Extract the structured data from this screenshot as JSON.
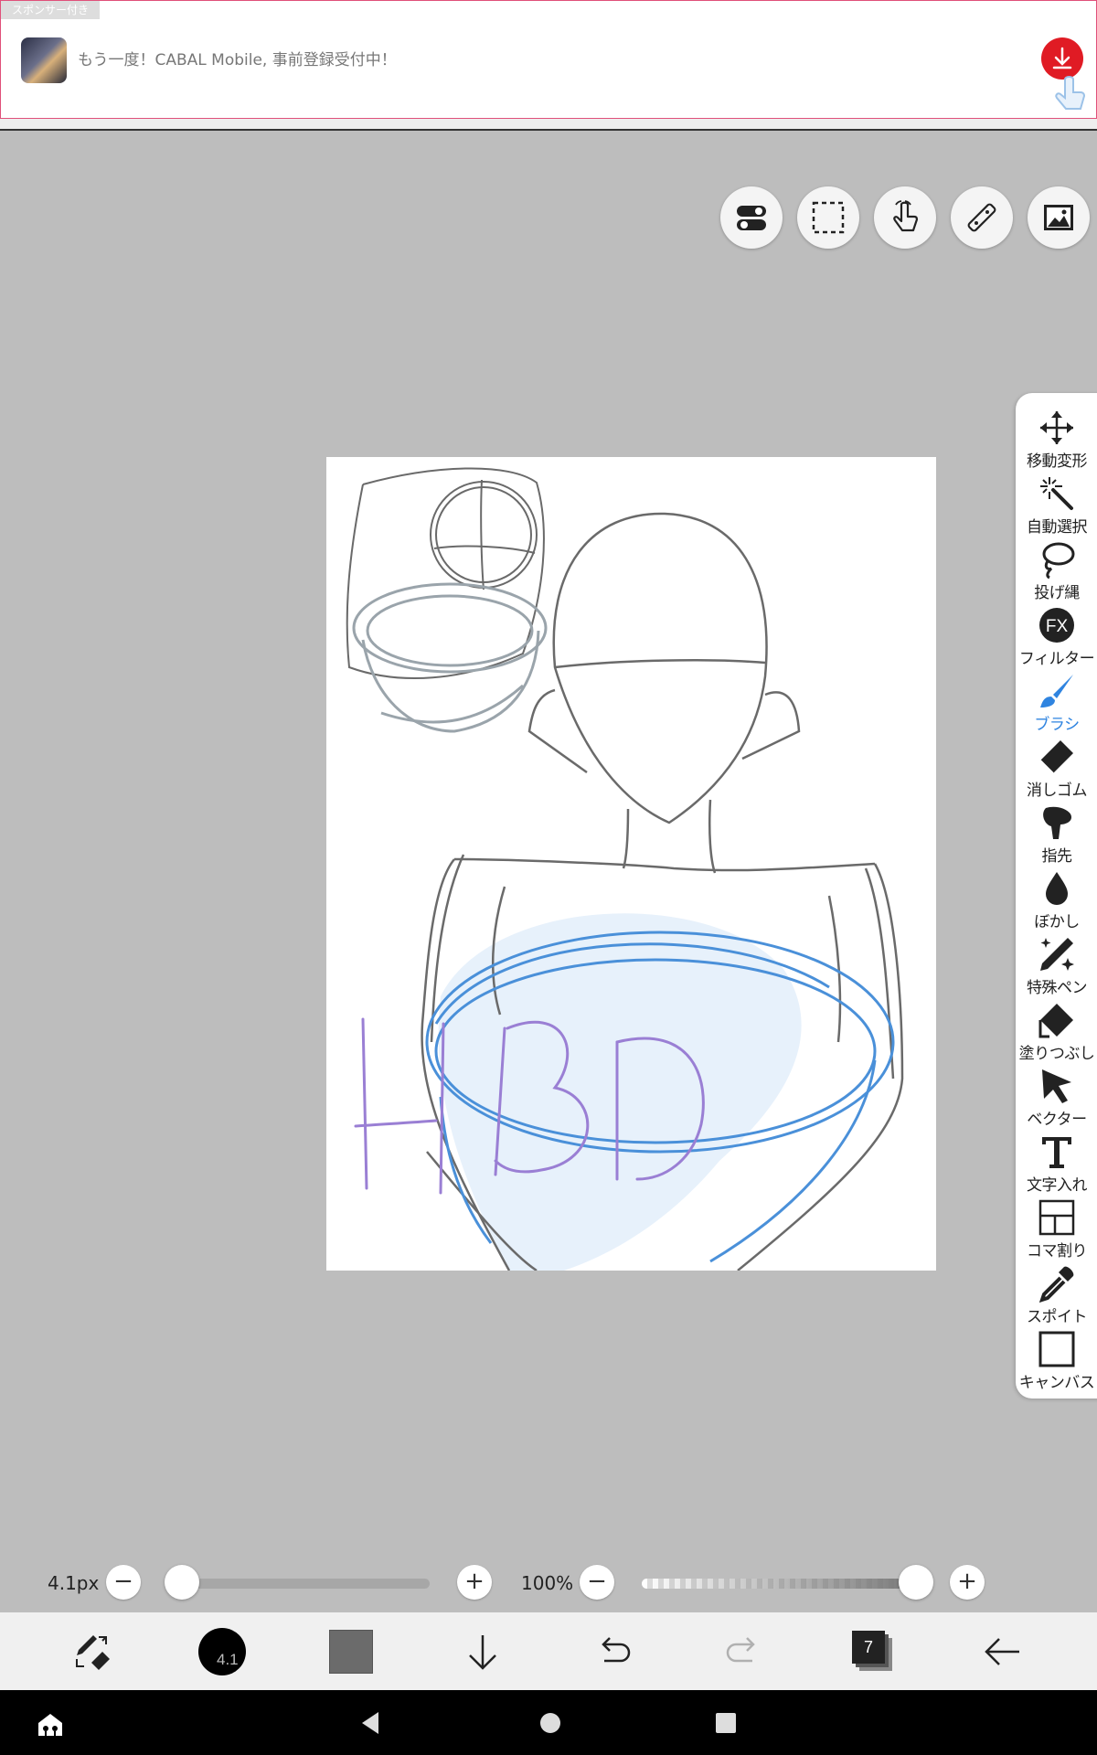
{
  "ad": {
    "tag": "スポンサー付き",
    "text": "もう一度！CABAL Mobile, 事前登録受付中！"
  },
  "top_buttons": [
    "toggle-icon",
    "selection-icon",
    "hand-icon",
    "ruler-icon",
    "image-icon"
  ],
  "canvas": {
    "handwritten_text": "HBD"
  },
  "tools": [
    {
      "label": "移動変形",
      "icon": "move-icon"
    },
    {
      "label": "自動選択",
      "icon": "magic-wand-icon"
    },
    {
      "label": "投げ縄",
      "icon": "lasso-icon"
    },
    {
      "label": "フィルター",
      "icon": "fx-icon",
      "glyph": "FX"
    },
    {
      "label": "ブラシ",
      "icon": "brush-icon",
      "active": true
    },
    {
      "label": "消しゴム",
      "icon": "eraser-icon"
    },
    {
      "label": "指先",
      "icon": "finger-icon"
    },
    {
      "label": "ぼかし",
      "icon": "blur-drop-icon"
    },
    {
      "label": "特殊ペン",
      "icon": "special-pen-icon"
    },
    {
      "label": "塗りつぶし",
      "icon": "fill-icon"
    },
    {
      "label": "ベクター",
      "icon": "vector-icon"
    },
    {
      "label": "文字入れ",
      "icon": "text-icon"
    },
    {
      "label": "コマ割り",
      "icon": "frame-divide-icon"
    },
    {
      "label": "スポイト",
      "icon": "eyedropper-icon"
    },
    {
      "label": "キャンバス",
      "icon": "canvas-icon"
    }
  ],
  "sliders": {
    "brush_size_label": "4.1px",
    "brush_size_value": 4.1,
    "opacity_label": "100%",
    "opacity_value": 1.0,
    "minus": "−",
    "plus": "+"
  },
  "bottom_bar": {
    "brush_size_badge": "4.1",
    "layer_count": "7",
    "color_swatch": "#6b6b6b"
  },
  "colors": {
    "accent_blue": "#2f84e0",
    "ad_red": "#e01b24"
  }
}
